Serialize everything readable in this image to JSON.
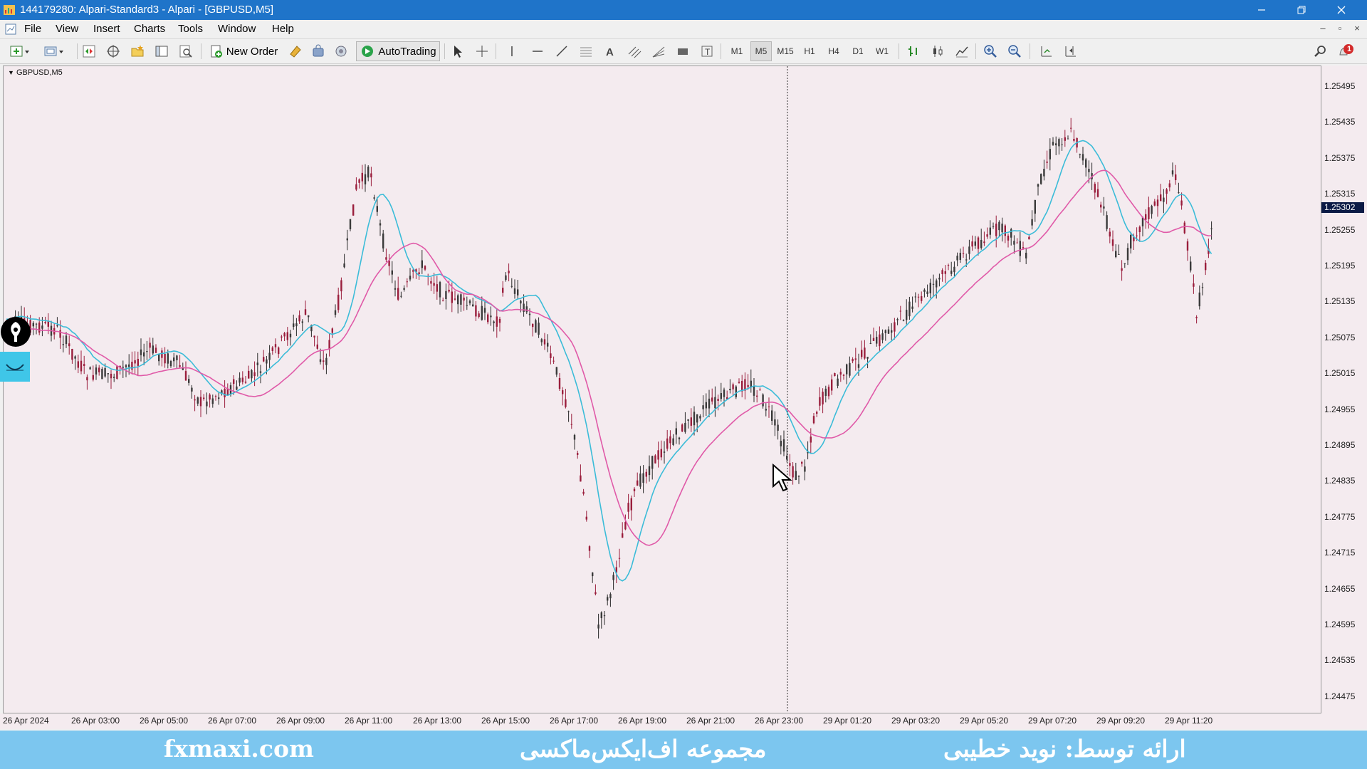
{
  "window": {
    "title": "144179280: Alpari-Standard3 - Alpari - [GBPUSD,M5]",
    "controls": [
      "minimize",
      "restore",
      "close"
    ]
  },
  "menu": {
    "items": [
      "File",
      "View",
      "Insert",
      "Charts",
      "Tools",
      "Window",
      "Help"
    ]
  },
  "toolbar": {
    "new_order_label": "New Order",
    "autotrading_label": "AutoTrading",
    "timeframes": [
      "M1",
      "M5",
      "M15",
      "H1",
      "H4",
      "D1",
      "W1"
    ],
    "active_timeframe": "M5",
    "notification_count": "1"
  },
  "chart": {
    "symbol_label": "GBPUSD,M5",
    "price_labels": [
      "1.25495",
      "1.25435",
      "1.25375",
      "1.25315",
      "1.25255",
      "1.25195",
      "1.25135",
      "1.25075",
      "1.25015",
      "1.24955",
      "1.24895",
      "1.24835",
      "1.24775",
      "1.24715",
      "1.24655",
      "1.24595",
      "1.24535",
      "1.24475"
    ],
    "current_price": "1.25302",
    "time_labels": [
      "26 Apr 2024",
      "26 Apr 03:00",
      "26 Apr 05:00",
      "26 Apr 07:00",
      "26 Apr 09:00",
      "26 Apr 11:00",
      "26 Apr 13:00",
      "26 Apr 15:00",
      "26 Apr 17:00",
      "26 Apr 19:00",
      "26 Apr 21:00",
      "26 Apr 23:00",
      "29 Apr 01:20",
      "29 Apr 03:20",
      "29 Apr 05:20",
      "29 Apr 07:20",
      "29 Apr 09:20",
      "29 Apr 11:20"
    ],
    "colors": {
      "background": "#f4ebef",
      "candle": "#9a1e3c",
      "candle_wick_up": "#2a2a2a",
      "ma_fast": "#3bbcd8",
      "ma_slow": "#e05aa8",
      "crosshair": "#333333"
    }
  },
  "footer": {
    "site": "fxmaxi.com",
    "collection": "مجموعه اف‌ایکس‌ماکسی",
    "presenter": "ارائه توسط: نوید خطیبی"
  }
}
